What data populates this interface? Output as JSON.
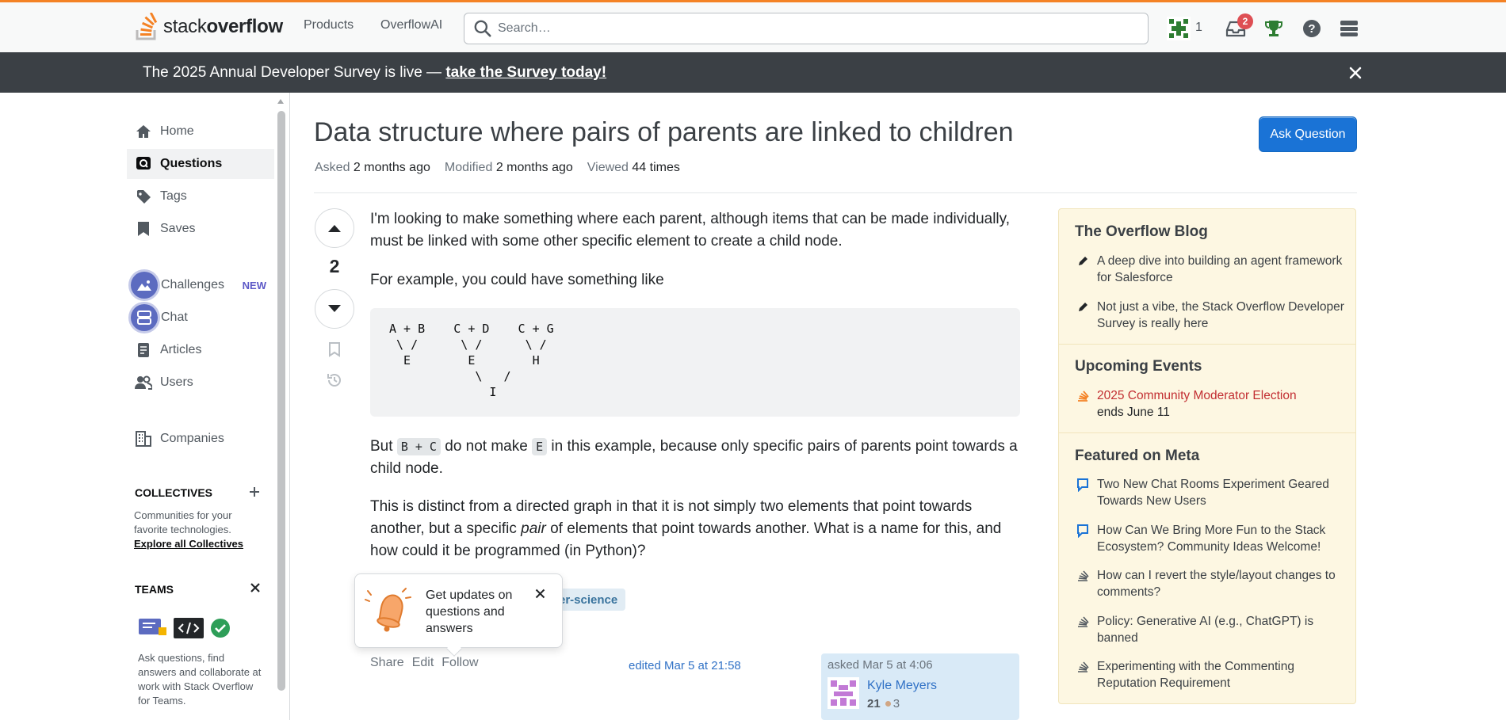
{
  "topbar": {
    "logo_word_light": "stack",
    "logo_word_bold": "overflow",
    "nav": [
      "Products",
      "OverflowAI"
    ],
    "search_placeholder": "Search…",
    "rep_count": "1",
    "inbox_badge": "2"
  },
  "banner": {
    "text": "The 2025 Annual Developer Survey is live — ",
    "link": "take the Survey today!"
  },
  "leftnav": {
    "items": [
      {
        "label": "Home",
        "icon": "home-icon"
      },
      {
        "label": "Questions",
        "icon": "questions-icon",
        "active": true
      },
      {
        "label": "Tags",
        "icon": "tag-icon"
      },
      {
        "label": "Saves",
        "icon": "bookmark-icon"
      },
      {
        "label": "Challenges",
        "icon": "mountain-icon",
        "badge": "NEW"
      },
      {
        "label": "Chat",
        "icon": "chat-icon"
      },
      {
        "label": "Articles",
        "icon": "article-icon"
      },
      {
        "label": "Users",
        "icon": "users-icon"
      },
      {
        "label": "Companies",
        "icon": "building-icon"
      }
    ],
    "collectives": {
      "heading": "COLLECTIVES",
      "desc": "Communities for your favorite technologies.",
      "link": "Explore all Collectives"
    },
    "teams": {
      "heading": "TEAMS",
      "desc": "Ask questions, find answers and collaborate at work with Stack Overflow for Teams."
    }
  },
  "question": {
    "title": "Data structure where pairs of parents are linked to children",
    "ask_button": "Ask Question",
    "asked_label": "Asked",
    "asked_value": "2 months ago",
    "modified_label": "Modified",
    "modified_value": "2 months ago",
    "viewed_label": "Viewed",
    "viewed_value": "44 times",
    "votes": "2",
    "p1": "I'm looking to make something where each parent, although items that can be made individually, must be linked with some other specific element to create a child node.",
    "p2": "For example, you could have something like",
    "code": "A + B    C + D    C + G\n \\ /      \\ /      \\ /\n  E        E        H\n            \\   /\n              I",
    "p3_a": "But ",
    "p3_code1": "B + C",
    "p3_b": " do not make ",
    "p3_code2": "E",
    "p3_c": " in this example, because only specific pairs of parents point towards a child node.",
    "p4_a": "This is distinct from a directed graph in that it is not simply two elements that point towards another, but a specific ",
    "p4_em": "pair",
    "p4_b": " of elements that point towards another. What is a name for this, and how could it be programmed (in Python)?",
    "tag": "ter-science",
    "popup_text": "Get updates on questions and answers",
    "actions": [
      "Share",
      "Edit",
      "Follow"
    ],
    "edited": "edited Mar 5 at 21:58",
    "asked_card": "asked Mar 5 at 4:06",
    "user_name": "Kyle Meyers",
    "user_rep": "21",
    "user_bronze": "3"
  },
  "sidebar": {
    "blog_heading": "The Overflow Blog",
    "blog_items": [
      "A deep dive into building an agent framework for Salesforce",
      "Not just a vibe, the Stack Overflow Developer Survey is really here"
    ],
    "events_heading": "Upcoming Events",
    "event_title": "2025 Community Moderator Election",
    "event_sub": "ends June 11",
    "meta_heading": "Featured on Meta",
    "meta_items": [
      "Two New Chat Rooms Experiment Geared Towards New Users",
      "How Can We Bring More Fun to the Stack Ecosystem? Community Ideas Welcome!",
      "How can I revert the style/layout changes to comments?",
      "Policy: Generative AI (e.g., ChatGPT) is banned",
      "Experimenting with the Commenting Reputation Requirement"
    ]
  },
  "colors": {
    "accent_orange": "#f48225",
    "primary_blue": "#1a73d6",
    "banner_bg": "#3b4045",
    "sidebar_bg": "#fdf7e2"
  }
}
